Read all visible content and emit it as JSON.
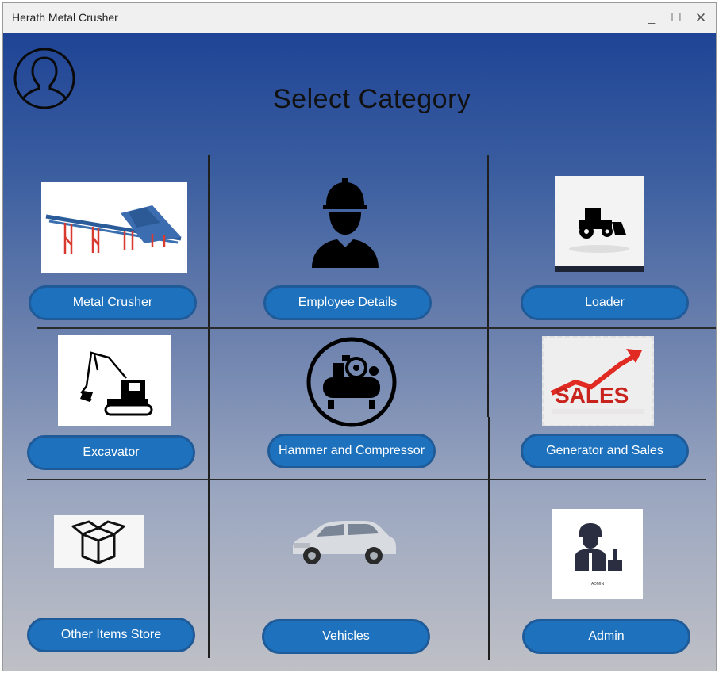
{
  "window": {
    "title": "Herath Metal Crusher",
    "controls": {
      "minimize": "_",
      "maximize": "☐",
      "close": "✕"
    }
  },
  "page": {
    "heading": "Select Category",
    "profile_icon": "user-profile-icon"
  },
  "categories": [
    {
      "label": "Metal Crusher",
      "icon": "metal-crusher-image"
    },
    {
      "label": "Employee Details",
      "icon": "worker-hardhat-icon"
    },
    {
      "label": "Loader",
      "icon": "loader-tractor-icon"
    },
    {
      "label": "Excavator",
      "icon": "excavator-image"
    },
    {
      "label": "Hammer and Compressor",
      "icon": "air-compressor-icon"
    },
    {
      "label": "Generator and Sales",
      "icon": "sales-arrow-image"
    },
    {
      "label": "Other Items Store",
      "icon": "open-box-icon"
    },
    {
      "label": "Vehicles",
      "icon": "car-image"
    },
    {
      "label": "Admin",
      "icon": "admin-avatar-icon"
    }
  ],
  "images": {
    "sales_text": "SALES",
    "admin_caption": "ADMIN"
  },
  "colors": {
    "button_fill": "#1e72bd",
    "button_border": "#1f5a99",
    "background_top": "#1f4495",
    "background_bottom": "#bfc0c6"
  }
}
